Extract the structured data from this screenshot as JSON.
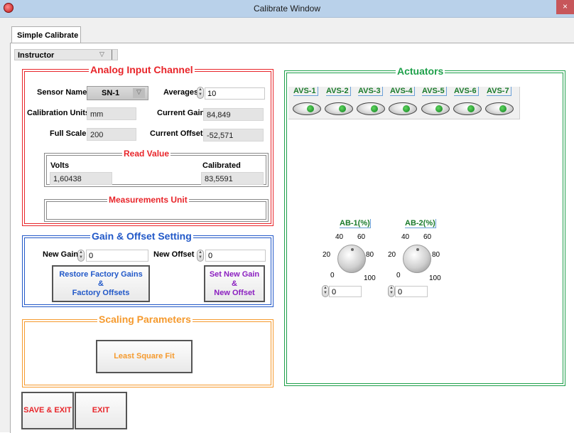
{
  "window": {
    "title": "Calibrate Window",
    "close": "×"
  },
  "tabs": [
    {
      "label": "Simple Calibrate"
    }
  ],
  "user_select": {
    "value": "Instructor"
  },
  "analog": {
    "title": "Analog Input Channel",
    "sensor_name_label": "Sensor Name",
    "sensor_name_value": "SN-1",
    "averages_label": "Averages",
    "averages_value": "10",
    "cal_units_label": "Calibration Units",
    "cal_units_value": "mm",
    "current_gain_label": "Current Gain",
    "current_gain_value": "84,849",
    "full_scale_label": "Full Scale",
    "full_scale_value": "200",
    "current_offset_label": "Current Offset",
    "current_offset_value": "-52,571",
    "read_value": {
      "title": "Read Value",
      "volts_label": "Volts",
      "volts_value": "1,60438",
      "calibrated_label": "Calibrated",
      "calibrated_value": "83,5591"
    },
    "measurements_title": "Measurements Unit",
    "measurements_value": ""
  },
  "gain_offset": {
    "title": "Gain & Offset Setting",
    "new_gain_label": "New Gain",
    "new_gain_value": "0",
    "new_offset_label": "New Offset",
    "new_offset_value": "0",
    "restore_line1": "Restore  Factory Gains",
    "restore_line2": "&",
    "restore_line3": "Factory Offsets",
    "set_line1": "Set  New Gain",
    "set_line2": "&",
    "set_line3": "New Offset"
  },
  "scaling": {
    "title": "Scaling Parameters",
    "least_square": "Least Square Fit"
  },
  "actuators": {
    "title": "Actuators",
    "items": [
      {
        "label": "AVS-1"
      },
      {
        "label": "AVS-2"
      },
      {
        "label": "AVS-3"
      },
      {
        "label": "AVS-4"
      },
      {
        "label": "AVS-5"
      },
      {
        "label": "AVS-6"
      },
      {
        "label": "AVS-7"
      }
    ],
    "knobs": [
      {
        "title": "AB-1(%)",
        "value": "0",
        "t0": "0",
        "t20": "20",
        "t40": "40",
        "t60": "60",
        "t80": "80",
        "t100": "100"
      },
      {
        "title": "AB-2(%)",
        "value": "0",
        "t0": "0",
        "t20": "20",
        "t40": "40",
        "t60": "60",
        "t80": "80",
        "t100": "100"
      }
    ]
  },
  "footer": {
    "save_exit": "SAVE & EXIT",
    "exit": "EXIT"
  },
  "colors": {
    "red": "#e8252a",
    "blue": "#2158c8",
    "orange": "#f59a2e",
    "green": "#1ea04a",
    "purple": "#8b1fc0"
  }
}
